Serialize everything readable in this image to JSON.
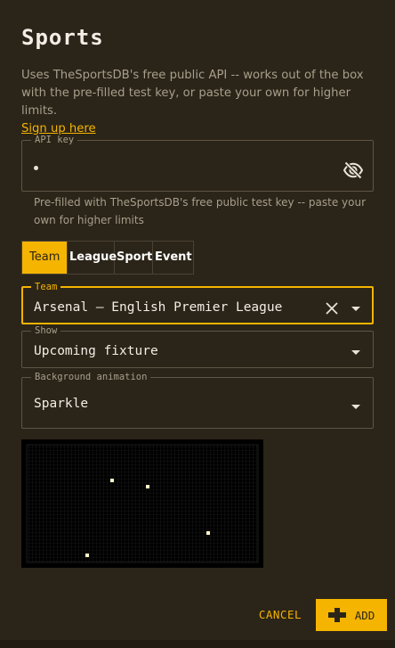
{
  "dialog": {
    "title": "Sports",
    "description": "Uses TheSportsDB's free public API -- works out of the box with the pre-filled test key, or paste your own for higher limits.",
    "signup_link": "Sign up here"
  },
  "api_key": {
    "legend": "API key",
    "value_masked": "•",
    "helper": "Pre-filled with TheSportsDB's free public test key -- paste your own for higher limits"
  },
  "tabs": [
    {
      "label": "Team",
      "selected": true
    },
    {
      "label": "League",
      "selected": false
    },
    {
      "label": "Sport",
      "selected": false
    },
    {
      "label": "Event",
      "selected": false
    }
  ],
  "team_field": {
    "legend": "Team",
    "value": "Arsenal — English Premier League"
  },
  "show_field": {
    "legend": "Show",
    "value": "Upcoming fixture"
  },
  "background_field": {
    "legend": "Background animation",
    "value": "Sparkle"
  },
  "actions": {
    "cancel": "CANCEL",
    "add": "ADD"
  },
  "colors": {
    "accent": "#f5b400",
    "background": "#2b2418",
    "text": "#e8e2d6",
    "muted": "#a89f8c"
  },
  "icons": {
    "api_key_toggle": "eye-off-icon",
    "clear": "close-icon",
    "dropdown": "caret-down-icon",
    "add": "plus-icon"
  }
}
